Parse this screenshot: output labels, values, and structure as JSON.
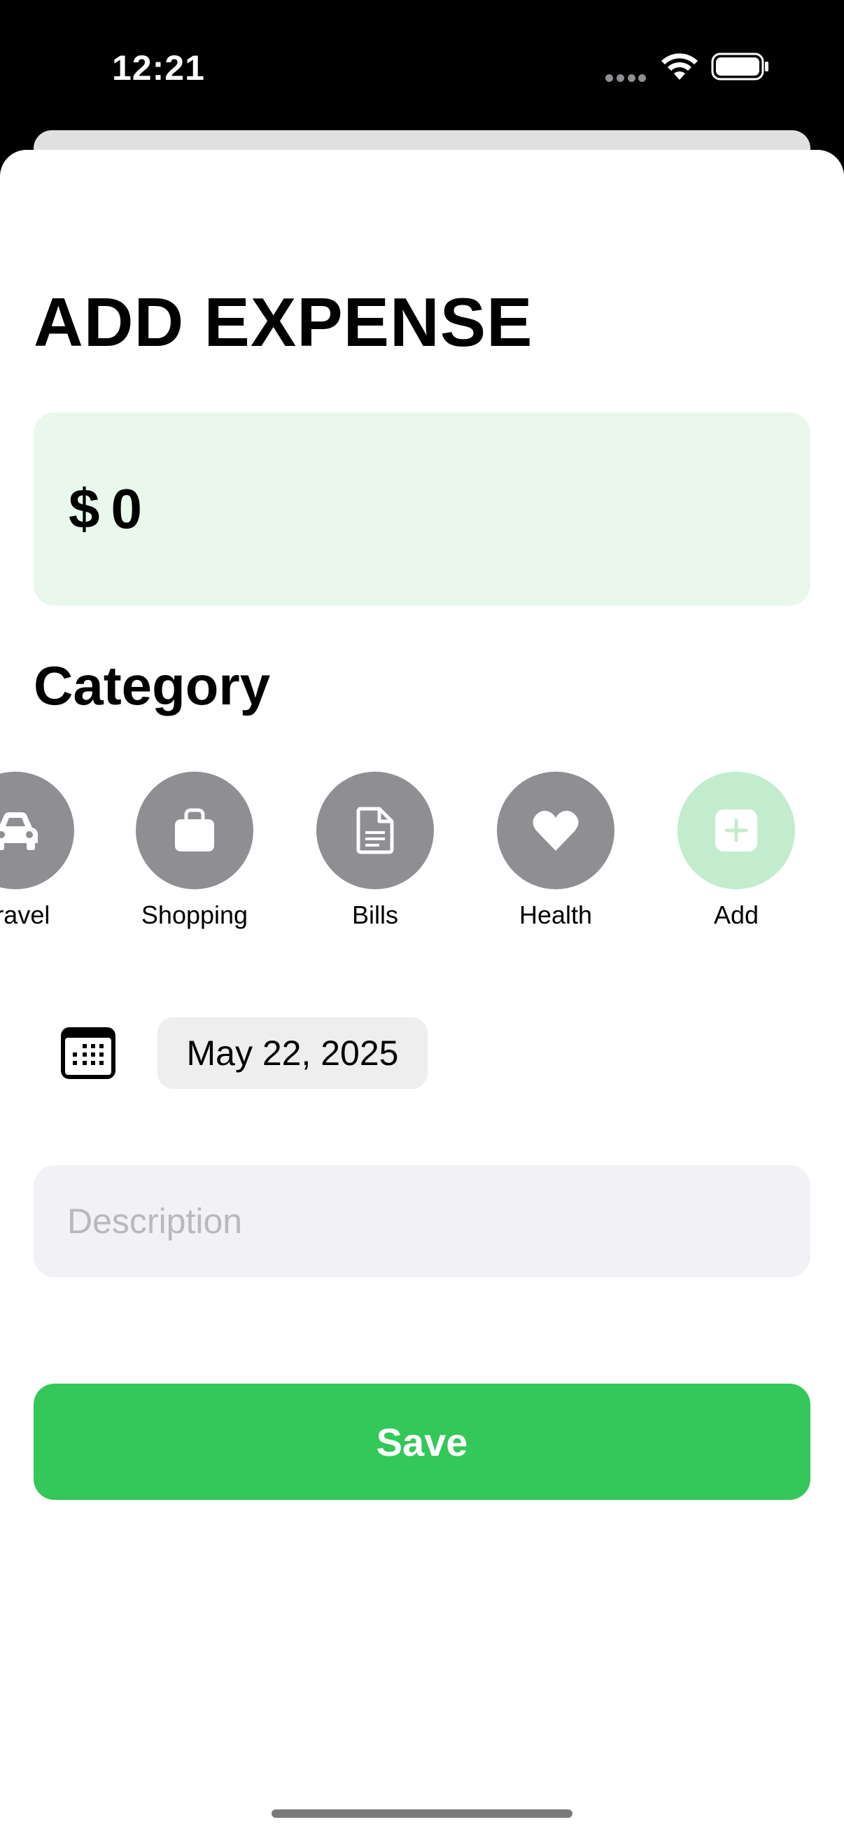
{
  "status_bar": {
    "time": "12:21"
  },
  "sheet": {
    "title": "ADD EXPENSE",
    "amount": {
      "currency": "$",
      "value": "0"
    },
    "category_heading": "Category",
    "categories": [
      {
        "label": "Travel",
        "icon": "car-icon",
        "color": "#8e8e93"
      },
      {
        "label": "Shopping",
        "icon": "shopping-bag-icon",
        "color": "#8e8e93"
      },
      {
        "label": "Bills",
        "icon": "document-icon",
        "color": "#8e8e93"
      },
      {
        "label": "Health",
        "icon": "heart-icon",
        "color": "#8e8e93"
      },
      {
        "label": "Add",
        "icon": "plus-icon",
        "color": "#c3ecce"
      }
    ],
    "date": {
      "icon": "calendar-icon",
      "value": "May 22, 2025"
    },
    "description": {
      "placeholder": "Description",
      "value": ""
    },
    "save_label": "Save"
  },
  "colors": {
    "accent_green": "#34c759",
    "amount_bg": "#e9f7ec",
    "category_gray": "#8e8e93",
    "add_green_light": "#c3ecce"
  }
}
